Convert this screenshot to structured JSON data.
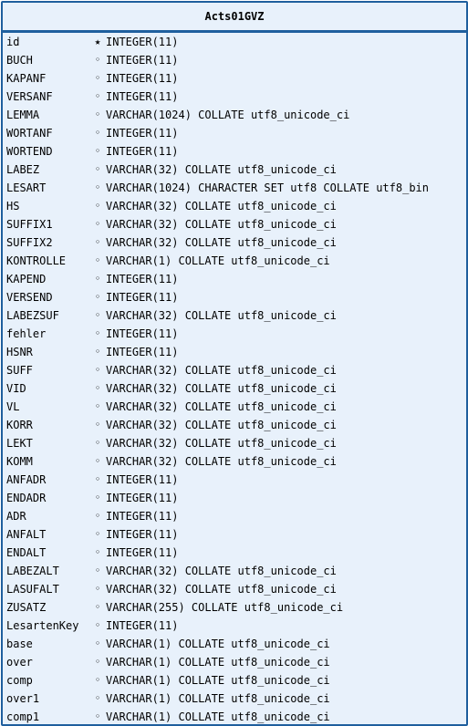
{
  "table": {
    "name": "Acts01GVZ",
    "columns": [
      {
        "name": "id",
        "marker": "★",
        "type": "INTEGER(11)"
      },
      {
        "name": "BUCH",
        "marker": "◦",
        "type": "INTEGER(11)"
      },
      {
        "name": "KAPANF",
        "marker": "◦",
        "type": "INTEGER(11)"
      },
      {
        "name": "VERSANF",
        "marker": "◦",
        "type": "INTEGER(11)"
      },
      {
        "name": "LEMMA",
        "marker": "◦",
        "type": "VARCHAR(1024) COLLATE utf8_unicode_ci"
      },
      {
        "name": "WORTANF",
        "marker": "◦",
        "type": "INTEGER(11)"
      },
      {
        "name": "WORTEND",
        "marker": "◦",
        "type": "INTEGER(11)"
      },
      {
        "name": "LABEZ",
        "marker": "◦",
        "type": "VARCHAR(32) COLLATE utf8_unicode_ci"
      },
      {
        "name": "LESART",
        "marker": "◦",
        "type": "VARCHAR(1024) CHARACTER SET utf8 COLLATE utf8_bin"
      },
      {
        "name": "HS",
        "marker": "◦",
        "type": "VARCHAR(32) COLLATE utf8_unicode_ci"
      },
      {
        "name": "SUFFIX1",
        "marker": "◦",
        "type": "VARCHAR(32) COLLATE utf8_unicode_ci"
      },
      {
        "name": "SUFFIX2",
        "marker": "◦",
        "type": "VARCHAR(32) COLLATE utf8_unicode_ci"
      },
      {
        "name": "KONTROLLE",
        "marker": "◦",
        "type": "VARCHAR(1) COLLATE utf8_unicode_ci"
      },
      {
        "name": "KAPEND",
        "marker": "◦",
        "type": "INTEGER(11)"
      },
      {
        "name": "VERSEND",
        "marker": "◦",
        "type": "INTEGER(11)"
      },
      {
        "name": "LABEZSUF",
        "marker": "◦",
        "type": "VARCHAR(32) COLLATE utf8_unicode_ci"
      },
      {
        "name": "fehler",
        "marker": "◦",
        "type": "INTEGER(11)"
      },
      {
        "name": "HSNR",
        "marker": "◦",
        "type": "INTEGER(11)"
      },
      {
        "name": "SUFF",
        "marker": "◦",
        "type": "VARCHAR(32) COLLATE utf8_unicode_ci"
      },
      {
        "name": "VID",
        "marker": "◦",
        "type": "VARCHAR(32) COLLATE utf8_unicode_ci"
      },
      {
        "name": "VL",
        "marker": "◦",
        "type": "VARCHAR(32) COLLATE utf8_unicode_ci"
      },
      {
        "name": "KORR",
        "marker": "◦",
        "type": "VARCHAR(32) COLLATE utf8_unicode_ci"
      },
      {
        "name": "LEKT",
        "marker": "◦",
        "type": "VARCHAR(32) COLLATE utf8_unicode_ci"
      },
      {
        "name": "KOMM",
        "marker": "◦",
        "type": "VARCHAR(32) COLLATE utf8_unicode_ci"
      },
      {
        "name": "ANFADR",
        "marker": "◦",
        "type": "INTEGER(11)"
      },
      {
        "name": "ENDADR",
        "marker": "◦",
        "type": "INTEGER(11)"
      },
      {
        "name": "ADR",
        "marker": "◦",
        "type": "INTEGER(11)"
      },
      {
        "name": "ANFALT",
        "marker": "◦",
        "type": "INTEGER(11)"
      },
      {
        "name": "ENDALT",
        "marker": "◦",
        "type": "INTEGER(11)"
      },
      {
        "name": "LABEZALT",
        "marker": "◦",
        "type": "VARCHAR(32) COLLATE utf8_unicode_ci"
      },
      {
        "name": "LASUFALT",
        "marker": "◦",
        "type": "VARCHAR(32) COLLATE utf8_unicode_ci"
      },
      {
        "name": "ZUSATZ",
        "marker": "◦",
        "type": "VARCHAR(255) COLLATE utf8_unicode_ci"
      },
      {
        "name": "LesartenKey",
        "marker": "◦",
        "type": "INTEGER(11)"
      },
      {
        "name": "base",
        "marker": "◦",
        "type": "VARCHAR(1) COLLATE utf8_unicode_ci"
      },
      {
        "name": "over",
        "marker": "◦",
        "type": "VARCHAR(1) COLLATE utf8_unicode_ci"
      },
      {
        "name": "comp",
        "marker": "◦",
        "type": "VARCHAR(1) COLLATE utf8_unicode_ci"
      },
      {
        "name": "over1",
        "marker": "◦",
        "type": "VARCHAR(1) COLLATE utf8_unicode_ci"
      },
      {
        "name": "comp1",
        "marker": "◦",
        "type": "VARCHAR(1) COLLATE utf8_unicode_ci"
      }
    ]
  },
  "colors": {
    "border": "#1f5f9e",
    "background": "#e8f1fb",
    "text": "#000000"
  }
}
